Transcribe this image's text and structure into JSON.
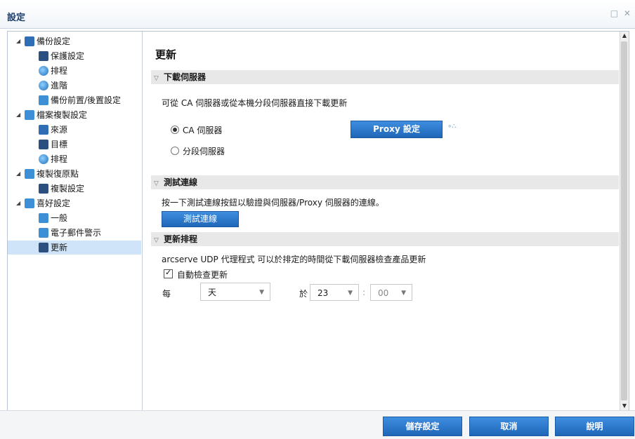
{
  "window": {
    "title": "設定",
    "controls": "□ ✕"
  },
  "sidebar": {
    "groups": [
      {
        "label": "備份設定",
        "items": [
          "保護設定",
          "排程",
          "進階",
          "備份前置/後置設定"
        ]
      },
      {
        "label": "檔案複製設定",
        "items": [
          "來源",
          "目標",
          "排程"
        ]
      },
      {
        "label": "複製復原點",
        "items": [
          "複製設定"
        ]
      },
      {
        "label": "喜好設定",
        "items": [
          "一般",
          "電子郵件警示",
          "更新"
        ]
      }
    ],
    "selected": "更新"
  },
  "main": {
    "heading": "更新",
    "download_server": {
      "title": "下載伺服器",
      "description": "可從 CA 伺服器或從本機分段伺服器直接下載更新",
      "option_ca": "CA 伺服器",
      "option_staging": "分段伺服器",
      "selected": "ca",
      "proxy_button": "Proxy 設定"
    },
    "test_connection": {
      "title": "測試連線",
      "description": "按一下測試連線按鈕以驗證與伺服器/Proxy 伺服器的連線。",
      "button": "測試連線"
    },
    "update_schedule": {
      "title": "更新排程",
      "description": "arcserve UDP 代理程式 可以於排定的時間從下載伺服器檢查產品更新",
      "auto_check_label": "自動檢查更新",
      "auto_check_checked": true,
      "every_label": "每",
      "frequency_value": "天",
      "at_label": "於",
      "hour_value": "23",
      "separator": ":",
      "minute_value": "00"
    }
  },
  "footer": {
    "save": "儲存設定",
    "cancel": "取消",
    "help": "說明"
  },
  "colors": {
    "accent": "#2470c4",
    "selected_row": "#cfe4f8",
    "section_bar": "#e8e8e8"
  }
}
